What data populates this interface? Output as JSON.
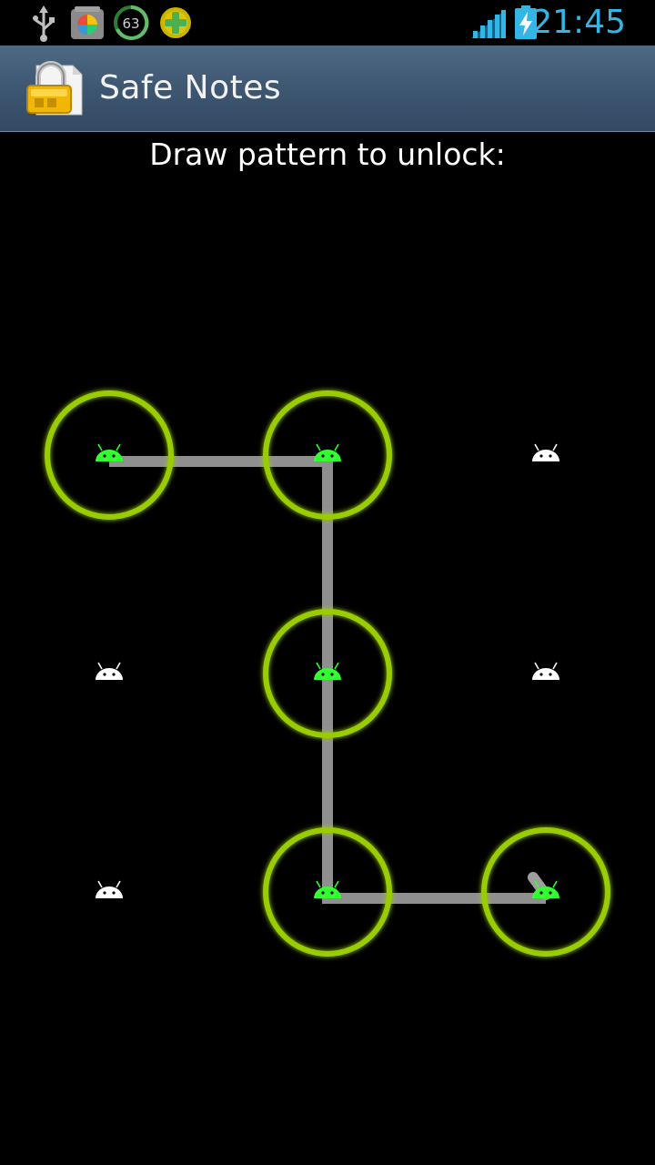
{
  "status_bar": {
    "time": "21:45",
    "notification_icons": [
      "usb-icon",
      "app-notification-icon",
      "battery-63-circle-icon",
      "game-plus-icon"
    ],
    "notification_badge": "63",
    "signal_icon": "cell-signal-icon",
    "battery_icon": "battery-charging-icon",
    "accent_color": "#33b5e5"
  },
  "action_bar": {
    "title": "Safe Notes",
    "app_icon": "lock-note-icon"
  },
  "unlock": {
    "prompt": "Draw pattern to unlock:",
    "grid_size": 3,
    "selected_sequence": [
      0,
      1,
      4,
      7,
      8
    ],
    "dot_icon": "android-head-icon",
    "colors": {
      "ring": "#9acd00",
      "selected_dot": "#33ff33",
      "idle_dot": "#ffffff",
      "path": "#9e9e9e"
    }
  }
}
